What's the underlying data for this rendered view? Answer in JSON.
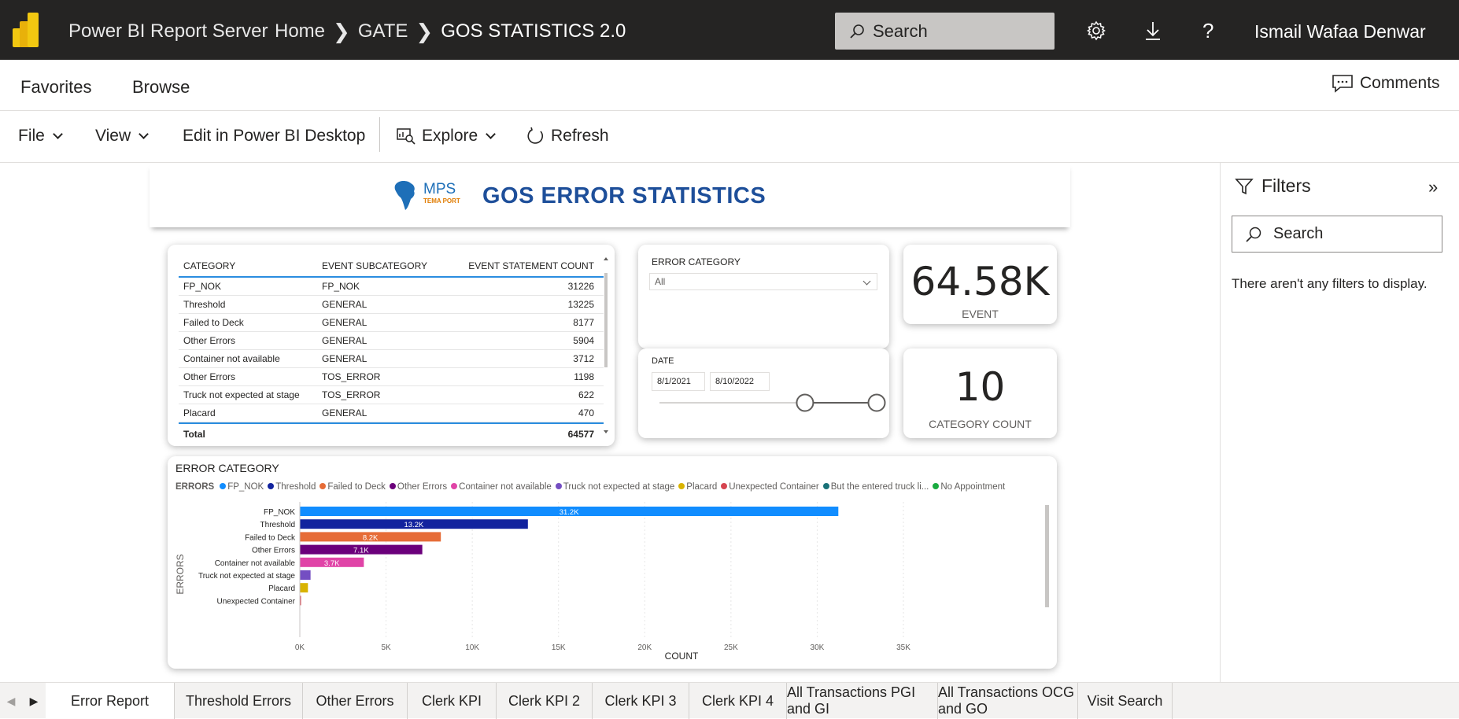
{
  "topbar": {
    "app_title": "Power BI Report Server",
    "breadcrumbs": [
      "Home",
      "GATE",
      "GOS STATISTICS 2.0"
    ],
    "search_placeholder": "Search",
    "user_name": "Ismail Wafaa Denwar",
    "icons": [
      "settings-gear-icon",
      "download-icon",
      "help-icon"
    ]
  },
  "nav": {
    "favorites": "Favorites",
    "browse": "Browse",
    "comments": "Comments"
  },
  "toolbar": {
    "file": "File",
    "view": "View",
    "edit": "Edit in Power BI Desktop",
    "explore": "Explore",
    "refresh": "Refresh"
  },
  "report": {
    "logo_text": "MPS",
    "logo_sub": "TEMA PORT",
    "title": "GOS ERROR STATISTICS",
    "table": {
      "headers": [
        "CATEGORY",
        "EVENT SUBCATEGORY",
        "EVENT STATEMENT COUNT"
      ],
      "rows": [
        [
          "FP_NOK",
          "FP_NOK",
          "31226"
        ],
        [
          "Threshold",
          "GENERAL",
          "13225"
        ],
        [
          "Failed to Deck",
          "GENERAL",
          "8177"
        ],
        [
          "Other Errors",
          "GENERAL",
          "5904"
        ],
        [
          "Container not available",
          "GENERAL",
          "3712"
        ],
        [
          "Other Errors",
          "TOS_ERROR",
          "1198"
        ],
        [
          "Truck not expected at stage",
          "TOS_ERROR",
          "622"
        ],
        [
          "Placard",
          "GENERAL",
          "470"
        ]
      ],
      "total_label": "Total",
      "total_value": "64577"
    },
    "error_slicer": {
      "label": "ERROR CATEGORY",
      "value": "All"
    },
    "date_slicer": {
      "label": "DATE",
      "start": "8/1/2021",
      "end": "8/10/2022",
      "range_start_fraction": 0.67,
      "range_end_fraction": 1.0
    },
    "kpi_event": {
      "value": "64.58K",
      "label": "EVENT"
    },
    "kpi_category": {
      "value": "10",
      "label": "CATEGORY COUNT"
    }
  },
  "chart_data": {
    "type": "bar",
    "orientation": "horizontal",
    "title": "ERROR CATEGORY",
    "legend_title": "ERRORS",
    "legend": [
      {
        "name": "FP_NOK",
        "color": "#118dff"
      },
      {
        "name": "Threshold",
        "color": "#12239e"
      },
      {
        "name": "Failed to Deck",
        "color": "#e66c37"
      },
      {
        "name": "Other Errors",
        "color": "#6b007b"
      },
      {
        "name": "Container not available",
        "color": "#e044a7"
      },
      {
        "name": "Truck not expected at stage",
        "color": "#744ec2"
      },
      {
        "name": "Placard",
        "color": "#d9b300"
      },
      {
        "name": "Unexpected Container",
        "color": "#d64550"
      },
      {
        "name": "But the entered truck li...",
        "color": "#197278"
      },
      {
        "name": "No Appointment",
        "color": "#1aab40"
      }
    ],
    "categories": [
      "FP_NOK",
      "Threshold",
      "Failed to Deck",
      "Other Errors",
      "Container not available",
      "Truck not expected at stage",
      "Placard",
      "Unexpected Container"
    ],
    "values": [
      31226,
      13225,
      8177,
      7102,
      3712,
      622,
      470,
      40
    ],
    "data_labels": [
      "31.2K",
      "13.2K",
      "8.2K",
      "7.1K",
      "3.7K",
      "",
      "",
      ""
    ],
    "colors": [
      "#118dff",
      "#12239e",
      "#e66c37",
      "#6b007b",
      "#e044a7",
      "#744ec2",
      "#d9b300",
      "#d64550"
    ],
    "xlabel": "COUNT",
    "ylabel": "ERRORS",
    "xlim": [
      0,
      35000
    ],
    "xticks": [
      "0K",
      "5K",
      "10K",
      "15K",
      "20K",
      "25K",
      "30K",
      "35K"
    ],
    "grid": true
  },
  "filters": {
    "title": "Filters",
    "search_placeholder": "Search",
    "empty_message": "There aren't any filters to display."
  },
  "tabs": [
    "Error Report",
    "Threshold Errors",
    "Other Errors",
    "Clerk KPI",
    "Clerk KPI 2",
    "Clerk KPI 3",
    "Clerk KPI 4",
    "All Transactions PGI and GI",
    "All Transactions OCG and GO",
    "Visit Search"
  ],
  "active_tab": "Error Report"
}
